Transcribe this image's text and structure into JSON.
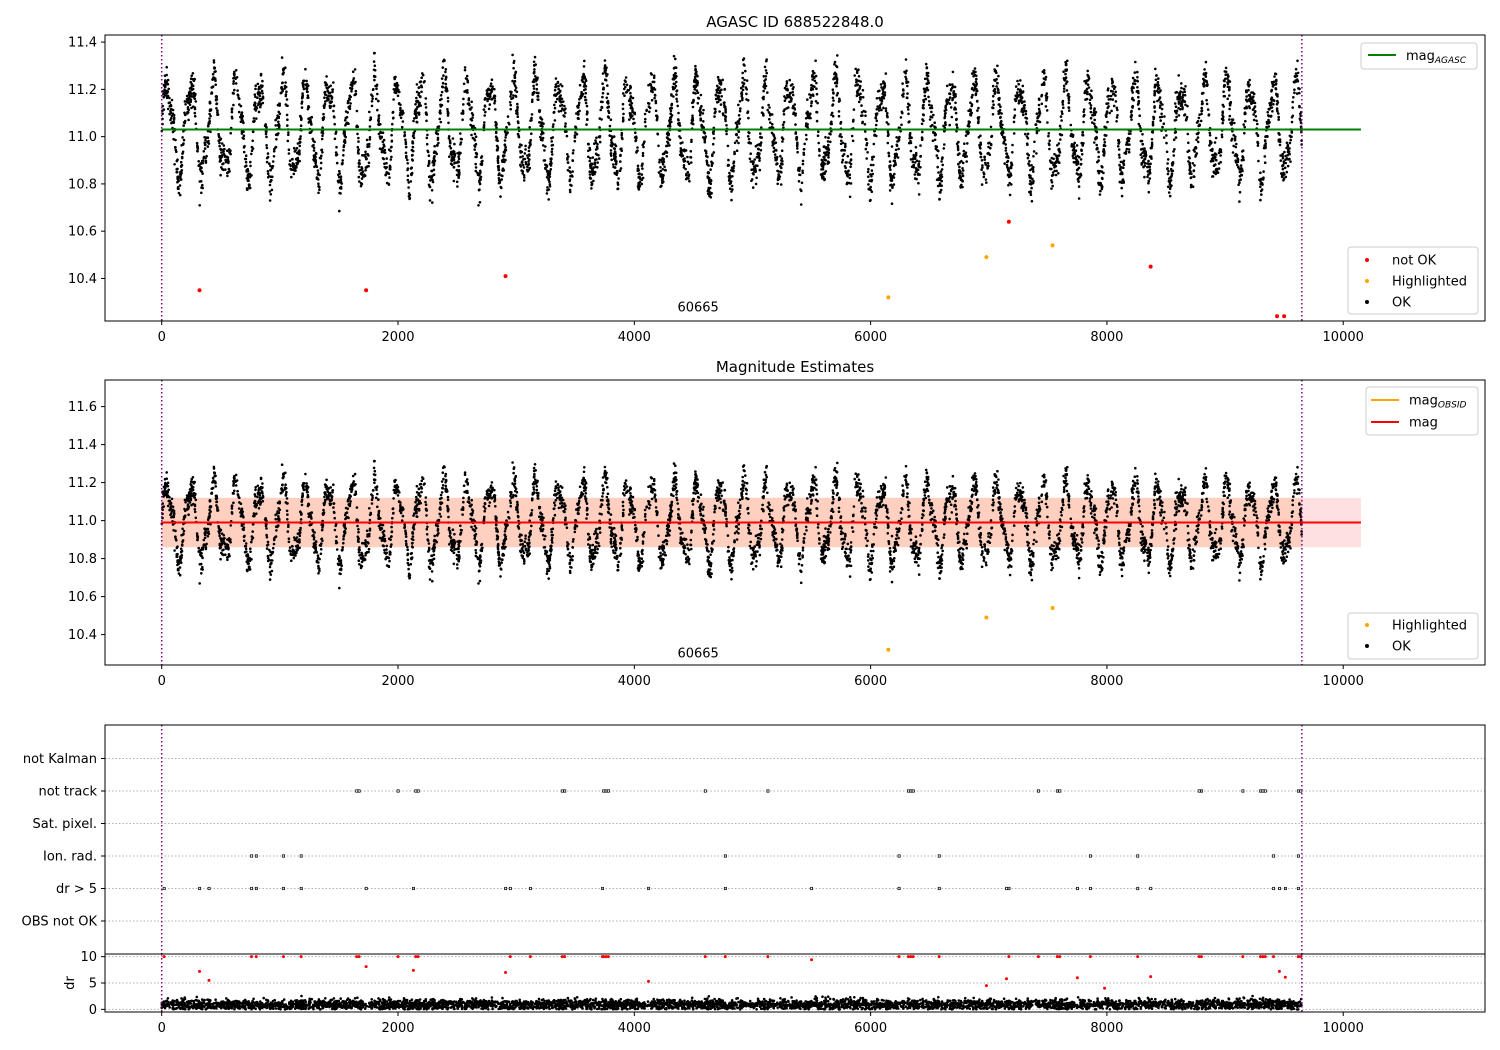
{
  "chart_data": [
    {
      "type": "scatter",
      "title": "AGASC ID 688522848.0",
      "xlabel": "",
      "ylabel": "",
      "xlim": [
        -480,
        11200
      ],
      "ylim": [
        10.22,
        11.43
      ],
      "x_ticks": [
        0,
        2000,
        4000,
        6000,
        8000,
        10000
      ],
      "y_ticks": [
        10.4,
        10.6,
        10.8,
        11.0,
        11.2,
        11.4
      ],
      "y_tick_labels": [
        "10.4",
        "10.6",
        "10.8",
        "11.0",
        "11.2",
        "11.4"
      ],
      "grid": false,
      "vlines": [
        0,
        9650
      ],
      "vline_color": "#800080",
      "annotation": {
        "text": "60665",
        "x": 4800,
        "y": 10.26
      },
      "hline": {
        "label": "mag",
        "subscript": "AGASC",
        "y": 11.03,
        "x_range": [
          0,
          10150
        ],
        "color": "#008000"
      },
      "legend_upper": {
        "position": "top-right",
        "entries": [
          {
            "label": "mag",
            "subscript": "AGASC",
            "color": "#008000"
          }
        ]
      },
      "legend_lower": {
        "position": "bottom-right",
        "entries": [
          {
            "label": "not OK",
            "color": "#ff0000"
          },
          {
            "label": "Highlighted",
            "color": "#ffa500"
          },
          {
            "label": "OK",
            "color": "#000000"
          }
        ]
      },
      "series": [
        {
          "name": "OK",
          "color": "#000000",
          "model": {
            "n": 5200,
            "x_range": [
              0,
              9650
            ],
            "center": 11.03,
            "amplitude": 0.19,
            "period": 195,
            "noise": 0.06
          }
        },
        {
          "name": "not OK",
          "color": "#ff0000",
          "x": [
            320,
            1730,
            2910,
            7170,
            8370,
            9440,
            9500
          ],
          "y": [
            10.35,
            10.35,
            10.41,
            10.64,
            10.45,
            10.24,
            10.24
          ]
        },
        {
          "name": "Highlighted",
          "color": "#ffa500",
          "x": [
            6150,
            6980,
            7540
          ],
          "y": [
            10.32,
            10.49,
            10.54
          ]
        }
      ]
    },
    {
      "type": "scatter",
      "title": "Magnitude Estimates",
      "xlabel": "",
      "ylabel": "",
      "xlim": [
        -480,
        11200
      ],
      "ylim": [
        10.24,
        11.74
      ],
      "x_ticks": [
        0,
        2000,
        4000,
        6000,
        8000,
        10000
      ],
      "y_ticks": [
        10.4,
        10.6,
        10.8,
        11.0,
        11.2,
        11.4,
        11.6
      ],
      "y_tick_labels": [
        "10.4",
        "10.6",
        "10.8",
        "11.0",
        "11.2",
        "11.4",
        "11.6"
      ],
      "grid": false,
      "vlines": [
        0,
        9650
      ],
      "vline_color": "#800080",
      "annotation": {
        "text": "60665",
        "x": 4800,
        "y": 10.28
      },
      "band_mag": {
        "y_low": 10.86,
        "y_high": 11.12,
        "x_range": [
          0,
          10150
        ],
        "color": "#ffcccc"
      },
      "band_obsid": {
        "y_low": 10.86,
        "y_high": 11.12,
        "x_range": [
          0,
          9650
        ],
        "color": "#ffb080"
      },
      "hline": {
        "label": "mag",
        "y": 10.99,
        "x_range": [
          0,
          10150
        ],
        "color": "#ff0000"
      },
      "hline_obsid": {
        "label": "mag",
        "subscript": "OBSID",
        "y": 10.99,
        "x_range": [
          0,
          9650
        ],
        "color": "#ffa500"
      },
      "legend_upper": {
        "position": "top-right",
        "entries": [
          {
            "label": "mag",
            "subscript": "OBSID",
            "color": "#ffa500"
          },
          {
            "label": "mag",
            "color": "#ff0000"
          }
        ]
      },
      "legend_lower": {
        "position": "bottom-right",
        "entries": [
          {
            "label": "Highlighted",
            "color": "#ffa500"
          },
          {
            "label": "OK",
            "color": "#000000"
          }
        ]
      },
      "series": [
        {
          "name": "OK",
          "color": "#000000",
          "model": {
            "n": 5200,
            "x_range": [
              0,
              9650
            ],
            "center": 10.99,
            "amplitude": 0.19,
            "period": 195,
            "noise": 0.06
          }
        },
        {
          "name": "Highlighted",
          "color": "#ffa500",
          "x": [
            6150,
            6980,
            7540
          ],
          "y": [
            10.32,
            10.49,
            10.54
          ]
        }
      ]
    },
    {
      "type": "scatter",
      "title": "",
      "xlabel": "",
      "ylabel": "",
      "xlim": [
        -480,
        11200
      ],
      "categories": [
        "OBS not OK",
        "dr > 5",
        "Ion. rad.",
        "Sat. pixel.",
        "not track",
        "not Kalman"
      ],
      "grid": true,
      "vlines": [
        0,
        9650
      ],
      "vline_color": "#800080",
      "flags": {
        "not Kalman": [],
        "not track": [
          1650,
          1670,
          2000,
          2150,
          2170,
          3390,
          3410,
          3740,
          3760,
          3780,
          4600,
          5130,
          6320,
          6340,
          6360,
          7420,
          7580,
          7600,
          8780,
          8800,
          9150,
          9300,
          9320,
          9340,
          9620,
          9640
        ],
        "Sat. pixel.": [],
        "Ion. rad.": [
          760,
          800,
          1030,
          1180,
          4770,
          6240,
          6580,
          7860,
          8260,
          9410,
          9620
        ],
        "dr > 5": [
          20,
          320,
          400,
          760,
          800,
          1030,
          1180,
          1730,
          2130,
          2910,
          2950,
          3120,
          3730,
          4120,
          4770,
          5500,
          6240,
          6580,
          7150,
          7170,
          7750,
          7860,
          8260,
          8370,
          9410,
          9460,
          9510,
          9620
        ],
        "OBS not OK": []
      }
    },
    {
      "type": "scatter",
      "title": "",
      "xlabel": "",
      "ylabel": "dr",
      "xlim": [
        -480,
        11200
      ],
      "ylim": [
        -0.5,
        10.5
      ],
      "x_ticks": [
        0,
        2000,
        4000,
        6000,
        8000,
        10000
      ],
      "y_ticks": [
        0,
        5,
        10
      ],
      "grid": true,
      "vlines": [
        0,
        9650
      ],
      "vline_color": "#800080",
      "series": [
        {
          "name": "OK",
          "color": "#000000",
          "model": {
            "n": 4500,
            "x_range": [
              0,
              9650
            ],
            "mean": 0.9,
            "spread": 1.1
          }
        },
        {
          "name": "not OK",
          "color": "#ff0000",
          "x": [
            20,
            320,
            400,
            760,
            800,
            1030,
            1180,
            1650,
            1670,
            1730,
            2000,
            2130,
            2150,
            2170,
            2910,
            2950,
            3120,
            3390,
            3410,
            3730,
            3740,
            3760,
            3780,
            4120,
            4600,
            4770,
            5130,
            5500,
            6240,
            6320,
            6340,
            6360,
            6580,
            6980,
            7150,
            7170,
            7420,
            7580,
            7600,
            7750,
            7860,
            7980,
            8260,
            8370,
            8780,
            8800,
            9150,
            9300,
            9320,
            9340,
            9410,
            9460,
            9510,
            9620,
            9640
          ],
          "y": [
            10,
            7.2,
            5.5,
            10,
            10,
            10,
            10,
            10,
            10,
            8.1,
            10,
            7.4,
            10,
            10,
            7,
            10,
            10,
            10,
            10,
            10,
            10,
            10,
            10,
            5.3,
            10,
            10,
            10,
            9.4,
            10,
            10,
            10,
            10,
            10,
            4.5,
            5.8,
            10,
            10,
            10,
            10,
            6,
            10,
            4,
            10,
            6.2,
            10,
            10,
            10,
            10,
            10,
            10,
            10,
            7.2,
            6.1,
            10,
            10
          ]
        }
      ]
    }
  ]
}
